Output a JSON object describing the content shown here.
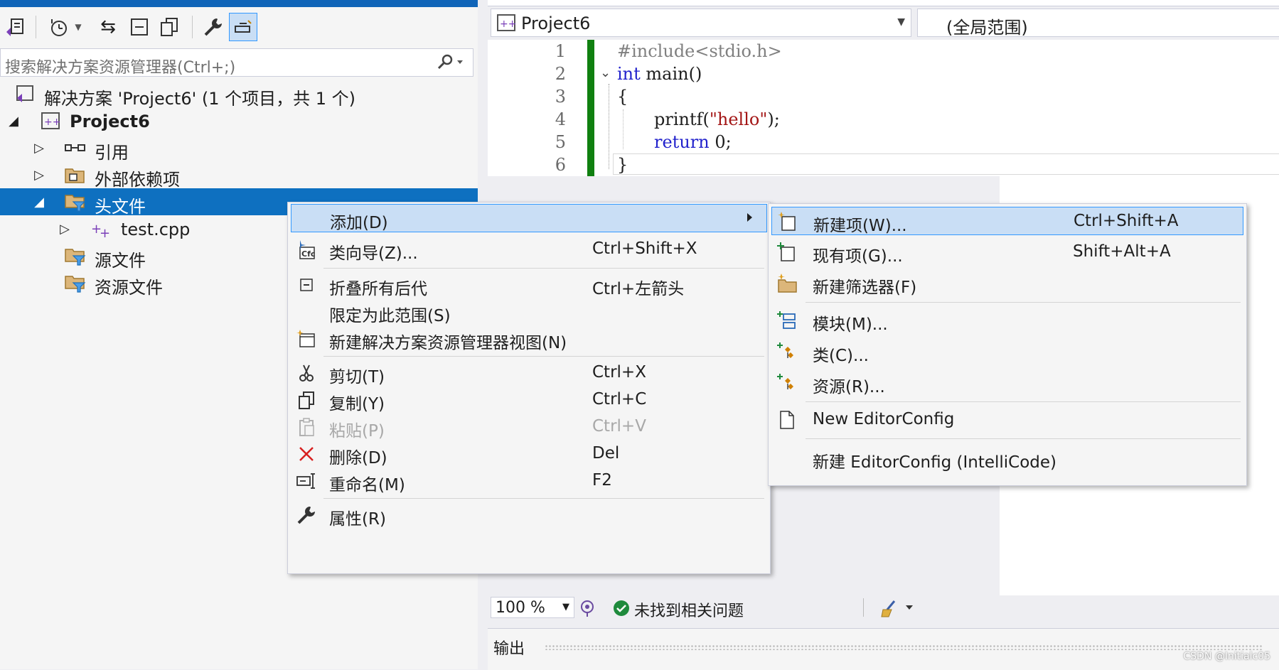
{
  "solution_explorer": {
    "search_placeholder": "搜索解决方案资源管理器(Ctrl+;)",
    "tree": {
      "solution_label": "解决方案 'Project6' (1 个项目，共 1 个)",
      "project_label": "Project6",
      "references_label": "引用",
      "external_deps_label": "外部依赖项",
      "header_files_label": "头文件",
      "test_file_label": "test.cpp",
      "source_files_label": "源文件",
      "resource_files_label": "资源文件"
    }
  },
  "editor": {
    "project_dropdown": "Project6",
    "scope_dropdown": "(全局范围)",
    "line_numbers": [
      "1",
      "2",
      "3",
      "4",
      "5",
      "6"
    ],
    "code": {
      "l1": "#include<stdio.h>",
      "l2_kw": "int",
      "l2_rest": " main()",
      "l3": "{",
      "l4_fn": "printf(",
      "l4_str": "\"hello\"",
      "l4_end": ");",
      "l5_kw": "return",
      "l5_rest": " 0;",
      "l6": "}"
    },
    "zoom_level": "100 %",
    "issues_status": "未找到相关问题",
    "output_title": "输出"
  },
  "context_menu": {
    "add": {
      "label": "添加(D)"
    },
    "class_wizard": {
      "label": "类向导(Z)...",
      "shortcut": "Ctrl+Shift+X"
    },
    "collapse_all": {
      "label": "折叠所有后代",
      "shortcut": "Ctrl+左箭头"
    },
    "scope_to_this": {
      "label": "限定为此范围(S)"
    },
    "new_explorer_view": {
      "label": "新建解决方案资源管理器视图(N)"
    },
    "cut": {
      "label": "剪切(T)",
      "shortcut": "Ctrl+X"
    },
    "copy": {
      "label": "复制(Y)",
      "shortcut": "Ctrl+C"
    },
    "paste": {
      "label": "粘贴(P)",
      "shortcut": "Ctrl+V"
    },
    "delete": {
      "label": "删除(D)",
      "shortcut": "Del"
    },
    "rename": {
      "label": "重命名(M)",
      "shortcut": "F2"
    },
    "properties": {
      "label": "属性(R)"
    }
  },
  "submenu": {
    "new_item": {
      "label": "新建项(W)...",
      "shortcut": "Ctrl+Shift+A"
    },
    "existing_item": {
      "label": "现有项(G)...",
      "shortcut": "Shift+Alt+A"
    },
    "new_filter": {
      "label": "新建筛选器(F)"
    },
    "module": {
      "label": "模块(M)..."
    },
    "class": {
      "label": "类(C)..."
    },
    "resource": {
      "label": "资源(R)..."
    },
    "new_editorconfig": {
      "label": "New EditorConfig"
    },
    "new_editorconfig_intellicode": {
      "label": "新建 EditorConfig (IntelliCode)"
    }
  },
  "watermark": "CSDN @Initialc05",
  "colors": {
    "accent": "#0e70c0",
    "highlight": "#c9def5",
    "highlight_border": "#3399ff",
    "change_bar": "#108010"
  }
}
